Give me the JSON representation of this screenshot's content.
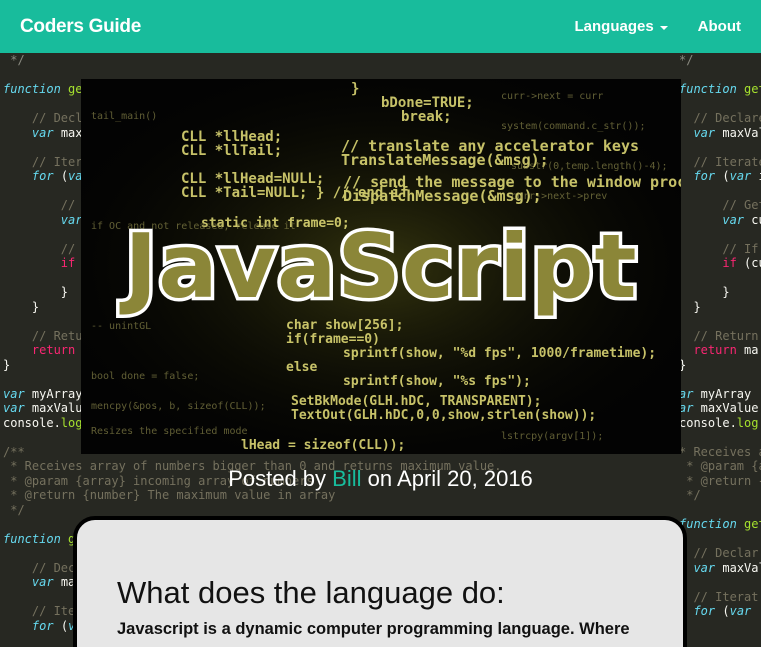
{
  "navbar": {
    "brand": "Coders Guide",
    "languages_label": "Languages",
    "about_label": "About",
    "background_color": "#18bc9c"
  },
  "hero": {
    "title": "JavaScript"
  },
  "post": {
    "prefix": "Posted by",
    "author": "Bill",
    "date_prefix": "on",
    "date": "April 20, 2016"
  },
  "content": {
    "heading": "What does the language do:",
    "text": "Javascript is a dynamic computer programming language. Where"
  }
}
